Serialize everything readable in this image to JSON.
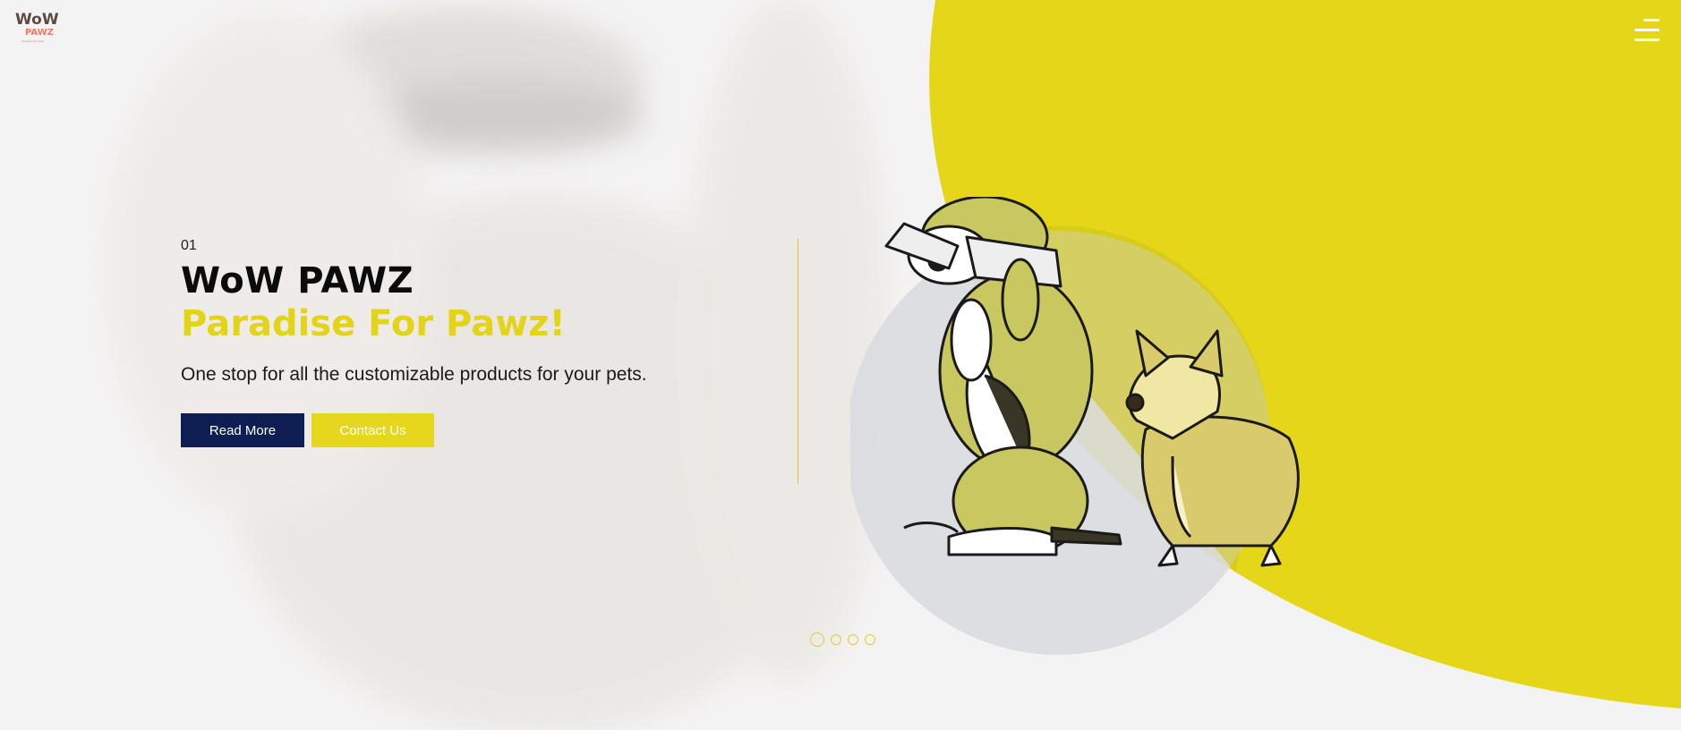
{
  "brand": {
    "logo_line1": "WoW",
    "logo_line2": "PAWZ",
    "logo_tagline": "Paradise For Pawz",
    "accent": "#e6d61c",
    "navy": "#0e1d52",
    "logo_color": "#f07a64"
  },
  "header": {
    "menu_icon": "hamburger-menu-icon"
  },
  "hero": {
    "slide_number": "01",
    "title": "WoW PAWZ",
    "subtitle": "Paradise For Pawz!",
    "description": "One stop for all the customizable products for your pets.",
    "read_more_label": "Read More",
    "contact_label": "Contact Us"
  },
  "slider": {
    "total": 4,
    "active": 1
  },
  "illustration": {
    "icon": "dogs-illustration-icon"
  }
}
